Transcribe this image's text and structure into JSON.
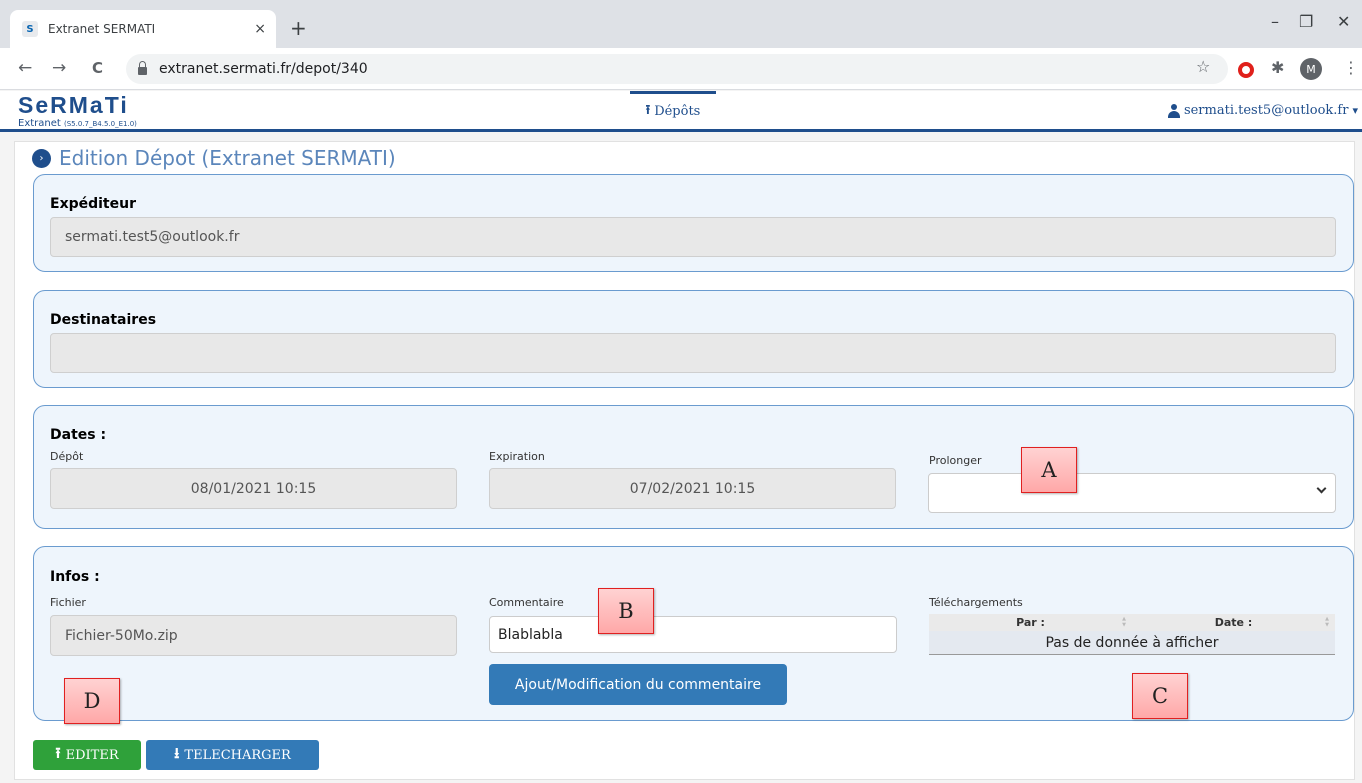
{
  "browser": {
    "tab_title": "Extranet SERMATI",
    "tab_close": "×",
    "new_tab": "+",
    "url": "extranet.sermati.fr/depot/340",
    "profile_initial": "M",
    "favicon": "S",
    "controls": {
      "minimize": "–",
      "restore": "❐",
      "close": "✕"
    },
    "nav": {
      "back": "←",
      "forward": "→",
      "reload": "C",
      "star": "☆",
      "puzzle": "✱",
      "menu": "⋮"
    }
  },
  "app": {
    "logo": "SeRMaTi",
    "subtitle": "Extranet",
    "version": "(S5.0.7_B4.5.0_E1.0)",
    "nav_icon": "⭱",
    "nav_link": "Dépôts",
    "user_email": "sermati.test5@outlook.fr",
    "user_caret": "▾"
  },
  "page": {
    "title_icon": "›",
    "title": "Edition Dépot (Extranet SERMATI)",
    "expediteur": {
      "title": "Expéditeur",
      "value": "sermati.test5@outlook.fr"
    },
    "destinataires": {
      "title": "Destinataires",
      "value": ""
    },
    "dates": {
      "title": "Dates :",
      "depot_label": "Dépôt",
      "depot_value": "08/01/2021 10:15",
      "expiration_label": "Expiration",
      "expiration_value": "07/02/2021 10:15",
      "prolonger_label": "Prolonger",
      "prolonger_value": ""
    },
    "infos": {
      "title": "Infos :",
      "fichier_label": "Fichier",
      "fichier_value": "Fichier-50Mo.zip",
      "commentaire_label": "Commentaire",
      "commentaire_value": "Blablabla",
      "comment_button": "Ajout/Modification du commentaire",
      "telechargements_label": "Téléchargements",
      "table_columns": [
        "Par :",
        "Date :"
      ],
      "table_empty": "Pas de donnée à afficher"
    },
    "actions": {
      "editer_icon": "⭱",
      "editer": "EDITER",
      "telecharger_icon": "⭳",
      "telecharger": "TELECHARGER"
    },
    "callouts": [
      "A",
      "B",
      "C",
      "D"
    ]
  },
  "colors": {
    "brand": "#1f4e8c",
    "section_bg": "#eef5fc",
    "section_border": "#6a9bcf",
    "btn_green": "#2fa13a",
    "btn_blue": "#337ab7",
    "callout_border": "#e02020"
  }
}
